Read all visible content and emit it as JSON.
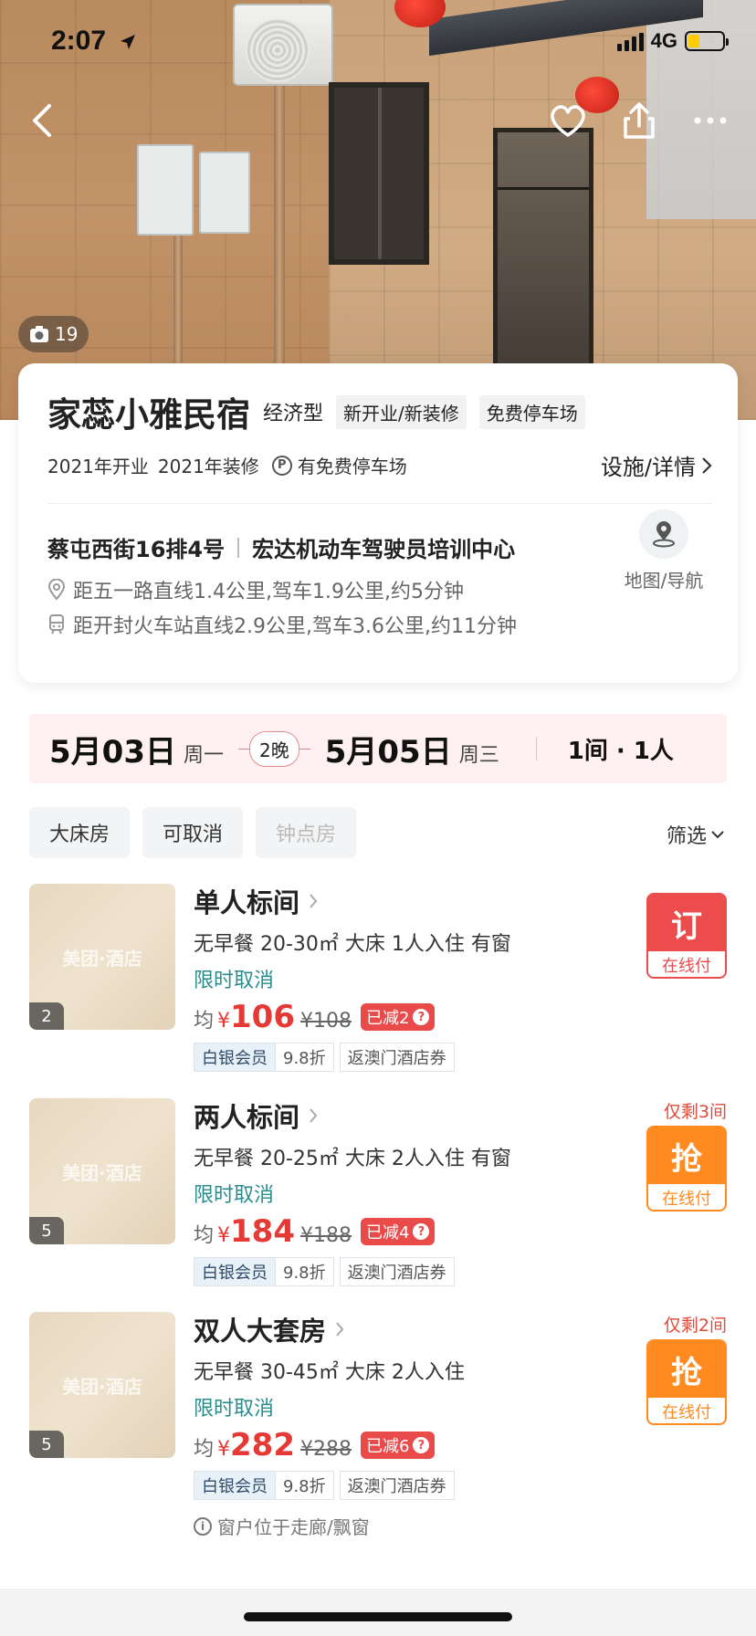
{
  "status_bar": {
    "time": "2:07",
    "network": "4G"
  },
  "hero": {
    "photo_count": "19"
  },
  "hotel": {
    "name": "家蕊小雅民宿",
    "type_tag": "经济型",
    "tags": [
      "新开业/新装修",
      "免费停车场"
    ],
    "opened": "2021年开业",
    "renovated": "2021年装修",
    "parking": "有免费停车场",
    "details_link": "设施/详情",
    "address": "蔡屯西街16排4号",
    "landmark": "宏达机动车驾驶员培训中心",
    "distance_1": "距五一路直线1.4公里,驾车1.9公里,约5分钟",
    "distance_2": "距开封火车站直线2.9公里,驾车3.6公里,约11分钟",
    "map_label": "地图/导航"
  },
  "dates": {
    "checkin": "5月03日",
    "checkin_week": "周一",
    "nights": "2晚",
    "checkout": "5月05日",
    "checkout_week": "周三",
    "rooms_guests": "1间 · 1人"
  },
  "filters": {
    "chips": [
      "大床房",
      "可取消",
      "钟点房"
    ],
    "filter_label": "筛选"
  },
  "rooms": [
    {
      "name": "单人标间",
      "desc": "无早餐 20-30㎡ 大床 1人入住 有窗",
      "cancel": "限时取消",
      "avg_label": "均",
      "currency": "¥",
      "price": "106",
      "orig_price": "¥108",
      "discount": "已减2",
      "member": "白银会员",
      "member_discount": "9.8折",
      "coupon": "返澳门酒店券",
      "photo_count": "2",
      "watermark": "美团·酒店",
      "remain": "",
      "button_main": "订",
      "button_sub": "在线付",
      "button_color": "#ec4c4c"
    },
    {
      "name": "两人标间",
      "desc": "无早餐 20-25㎡ 大床 2人入住 有窗",
      "cancel": "限时取消",
      "avg_label": "均",
      "currency": "¥",
      "price": "184",
      "orig_price": "¥188",
      "discount": "已减4",
      "member": "白银会员",
      "member_discount": "9.8折",
      "coupon": "返澳门酒店券",
      "photo_count": "5",
      "watermark": "美团·酒店",
      "remain": "仅剩3间",
      "button_main": "抢",
      "button_sub": "在线付",
      "button_color": "#ff8a1f"
    },
    {
      "name": "双人大套房",
      "desc": "无早餐 30-45㎡ 大床 2人入住",
      "cancel": "限时取消",
      "avg_label": "均",
      "currency": "¥",
      "price": "282",
      "orig_price": "¥288",
      "discount": "已减6",
      "member": "白银会员",
      "member_discount": "9.8折",
      "coupon": "返澳门酒店券",
      "photo_count": "5",
      "watermark": "美团·酒店",
      "remain": "仅剩2间",
      "button_main": "抢",
      "button_sub": "在线付",
      "button_color": "#ff8a1f",
      "note": "窗户位于走廊/飘窗"
    }
  ]
}
